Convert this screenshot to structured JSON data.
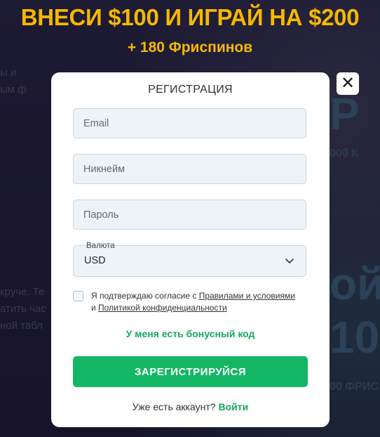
{
  "promo": {
    "title": "ВНЕСИ $100 И ИГРАЙ НА $200",
    "subtitle": "+ 180 Фриспинов"
  },
  "modal": {
    "title": "РЕГИСТРАЦИЯ",
    "close_icon": "close-icon"
  },
  "form": {
    "email_placeholder": "Email",
    "nickname_placeholder": "Никнейм",
    "password_placeholder": "Пароль",
    "currency": {
      "label": "Валюта",
      "value": "USD",
      "icon": "chevron-down-icon"
    },
    "consent": {
      "text_before": "Я подтверждаю согласие с ",
      "rules_link": "Правилами и условиями",
      "and": " и ",
      "privacy_link": "Политикой конфиденциальности"
    },
    "bonus_code_link": "У меня есть бонусный код",
    "submit_label": "ЗАРЕГИСТРИРУЙСЯ",
    "have_account_text": "Уже есть аккаунт? ",
    "login_link": "Войти"
  },
  "background_fragments": {
    "left_text_1": "ы и",
    "left_text_2": "ым ф",
    "left_text_3": "круче. Те",
    "left_text_4": "атить час",
    "left_text_5": "ной табл",
    "right_big_1": "Р",
    "right_small_1": "000 К",
    "right_big_2": "ой",
    "right_big_3": "10",
    "right_small_2": "00 ФРИС"
  },
  "colors": {
    "accent_yellow": "#f5b800",
    "accent_green": "#14b765",
    "link_green": "#16a860",
    "background": "#1c1830"
  }
}
